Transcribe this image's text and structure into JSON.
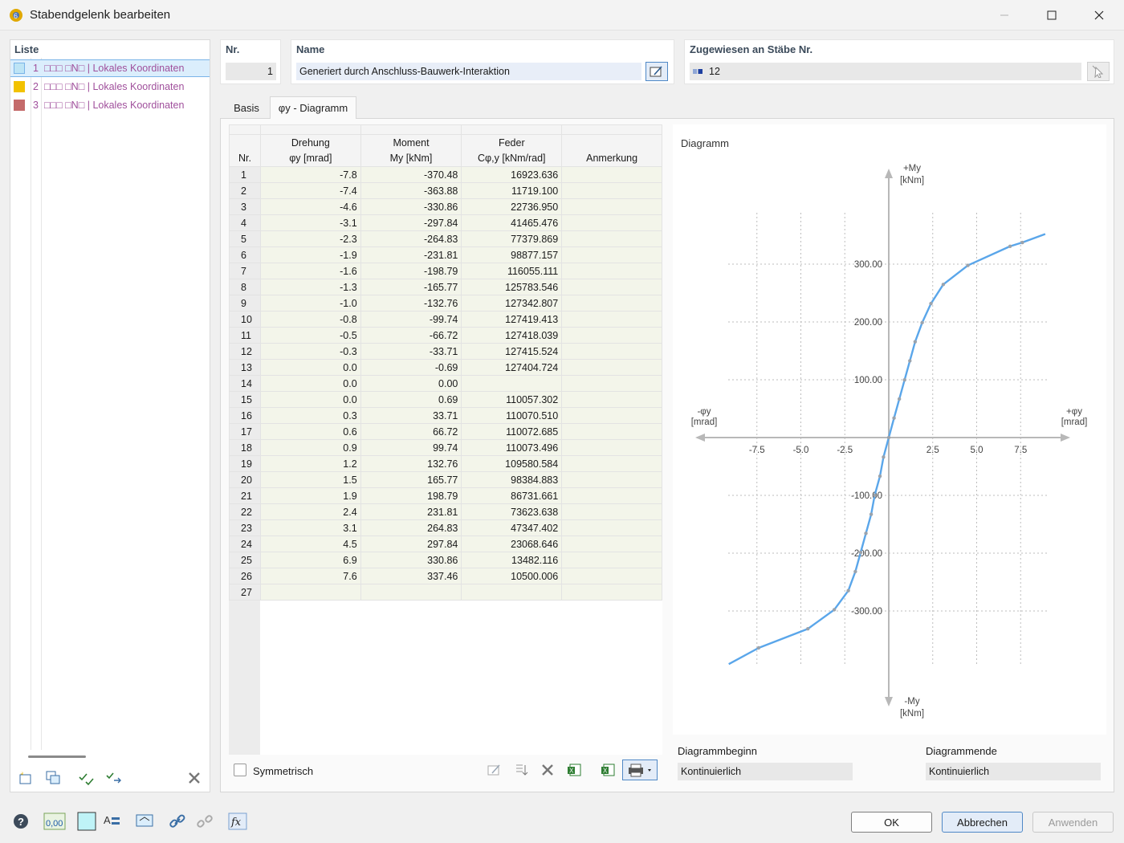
{
  "window": {
    "title": "Stabendgelenk bearbeiten"
  },
  "list": {
    "header": "Liste",
    "items": [
      {
        "num": "1",
        "label": "□□□ □N□ | Lokales Koordinaten",
        "color": "#bde4f5"
      },
      {
        "num": "2",
        "label": "□□□ □N□ | Lokales Koordinaten",
        "color": "#f2c200"
      },
      {
        "num": "3",
        "label": "□□□ □N□ | Lokales Koordinaten",
        "color": "#c46a6a"
      }
    ]
  },
  "header": {
    "nr_label": "Nr.",
    "nr_value": "1",
    "name_label": "Name",
    "name_value": "Generiert durch Anschluss-Bauwerk-Interaktion",
    "assigned_label": "Zugewiesen an Stäbe Nr.",
    "assigned_value": "12"
  },
  "tabs": {
    "basis": "Basis",
    "diagramm": "φy - Diagramm"
  },
  "table": {
    "headers": {
      "nr": "Nr.",
      "drehung_top": "Drehung",
      "drehung_bottom": "φy [mrad]",
      "moment_top": "Moment",
      "moment_bottom": "My [kNm]",
      "feder_top": "Feder",
      "feder_bottom": "Cφ,y [kNm/rad]",
      "anmerkung": "Anmerkung"
    },
    "rows": [
      [
        "1",
        "-7.8",
        "-370.48",
        "16923.636"
      ],
      [
        "2",
        "-7.4",
        "-363.88",
        "11719.100"
      ],
      [
        "3",
        "-4.6",
        "-330.86",
        "22736.950"
      ],
      [
        "4",
        "-3.1",
        "-297.84",
        "41465.476"
      ],
      [
        "5",
        "-2.3",
        "-264.83",
        "77379.869"
      ],
      [
        "6",
        "-1.9",
        "-231.81",
        "98877.157"
      ],
      [
        "7",
        "-1.6",
        "-198.79",
        "116055.111"
      ],
      [
        "8",
        "-1.3",
        "-165.77",
        "125783.546"
      ],
      [
        "9",
        "-1.0",
        "-132.76",
        "127342.807"
      ],
      [
        "10",
        "-0.8",
        "-99.74",
        "127419.413"
      ],
      [
        "11",
        "-0.5",
        "-66.72",
        "127418.039"
      ],
      [
        "12",
        "-0.3",
        "-33.71",
        "127415.524"
      ],
      [
        "13",
        "0.0",
        "-0.69",
        "127404.724"
      ],
      [
        "14",
        "0.0",
        "0.00",
        ""
      ],
      [
        "15",
        "0.0",
        "0.69",
        "110057.302"
      ],
      [
        "16",
        "0.3",
        "33.71",
        "110070.510"
      ],
      [
        "17",
        "0.6",
        "66.72",
        "110072.685"
      ],
      [
        "18",
        "0.9",
        "99.74",
        "110073.496"
      ],
      [
        "19",
        "1.2",
        "132.76",
        "109580.584"
      ],
      [
        "20",
        "1.5",
        "165.77",
        "98384.883"
      ],
      [
        "21",
        "1.9",
        "198.79",
        "86731.661"
      ],
      [
        "22",
        "2.4",
        "231.81",
        "73623.638"
      ],
      [
        "23",
        "3.1",
        "264.83",
        "47347.402"
      ],
      [
        "24",
        "4.5",
        "297.84",
        "23068.646"
      ],
      [
        "25",
        "6.9",
        "330.86",
        "13482.116"
      ],
      [
        "26",
        "7.6",
        "337.46",
        "10500.006"
      ],
      [
        "27",
        "",
        "",
        ""
      ]
    ],
    "symmetric_label": "Symmetrisch"
  },
  "diagram": {
    "title": "Diagramm",
    "y_pos_label": "+My",
    "y_neg_label": "-My",
    "y_unit": "[kNm]",
    "x_pos_label": "+φy",
    "x_neg_label": "-φy",
    "x_unit": "[mrad]",
    "start_label": "Diagrammbeginn",
    "start_value": "Kontinuierlich",
    "end_label": "Diagrammende",
    "end_value": "Kontinuierlich"
  },
  "chart_data": {
    "type": "line",
    "title": "Diagramm",
    "xlabel": "φy [mrad]",
    "ylabel": "My [kNm]",
    "x_ticks": [
      -7.5,
      -5.0,
      -2.5,
      2.5,
      5.0,
      7.5
    ],
    "x_tick_labels": [
      "-7.5",
      "-5.0",
      "-2.5",
      "2.5",
      "5.0",
      "7.5"
    ],
    "y_ticks": [
      300,
      200,
      100,
      -100,
      -200,
      -300
    ],
    "y_tick_labels": [
      "300.00",
      "200.00",
      "100.00",
      "-100.00",
      "-200.00",
      "-300.00"
    ],
    "xlim": [
      -10.0,
      10.0
    ],
    "ylim": [
      -400,
      450
    ],
    "grid": true,
    "series": [
      {
        "color": "#5aa6ea",
        "x": [
          -9.1,
          -7.4,
          -4.6,
          -3.1,
          -2.3,
          -1.9,
          -1.6,
          -1.3,
          -1.0,
          -0.8,
          -0.5,
          -0.3,
          0.0,
          0.3,
          0.6,
          0.9,
          1.2,
          1.5,
          1.9,
          2.4,
          3.1,
          4.5,
          6.9,
          7.6,
          8.9
        ],
        "y": [
          -392,
          -363.88,
          -330.86,
          -297.84,
          -264.83,
          -231.81,
          -198.79,
          -165.77,
          -132.76,
          -99.74,
          -66.72,
          -33.71,
          0.0,
          33.71,
          66.72,
          99.74,
          132.76,
          165.77,
          198.79,
          231.81,
          264.83,
          297.84,
          330.86,
          337.46,
          352
        ]
      }
    ]
  },
  "buttons": {
    "ok": "OK",
    "cancel": "Abbrechen",
    "apply": "Anwenden"
  },
  "colors": {
    "accent": "#2b7cd3",
    "list_text": "#a0509c",
    "chart_line": "#5aa6ea"
  }
}
